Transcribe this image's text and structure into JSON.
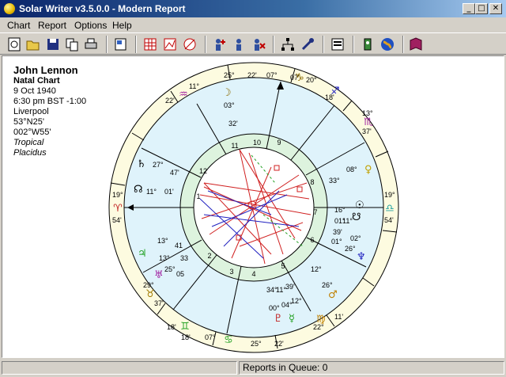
{
  "window": {
    "title": "Solar Writer  v3.5.0.0 - Modern Report",
    "btn_min": "_",
    "btn_max": "□",
    "btn_close": "✕"
  },
  "menu": [
    "Chart",
    "Report",
    "Options",
    "Help"
  ],
  "toolbar_icons": [
    "new-chart-icon",
    "open-icon",
    "save-icon",
    "copy-icon",
    "print-icon",
    "preview-icon",
    "grid-icon",
    "graph-icon",
    "bi-wheel-icon",
    "add-person-icon",
    "person-icon",
    "delete-person-icon",
    "network-icon",
    "tools-icon",
    "properties-icon",
    "transit-icon",
    "globe-icon",
    "book-icon"
  ],
  "person": {
    "name": "John Lennon",
    "chart_type": "Natal Chart",
    "date": "9 Oct 1940",
    "time": "6:30 pm BST  -1:00",
    "place": "Liverpool",
    "lat": "53°N25'",
    "lon": "002°W55'",
    "zodiac": "Tropical",
    "house_system": "Placidus"
  },
  "cusps": [
    {
      "label": "19°",
      "sub": "54'"
    },
    {
      "label": "19°",
      "sub": "54'"
    },
    {
      "label": "07°",
      "sub": "07'"
    },
    {
      "label": "25°",
      "sub": "22'"
    }
  ],
  "house_numbers": [
    "1",
    "2",
    "3",
    "4",
    "5",
    "6",
    "7",
    "8",
    "9",
    "10",
    "11",
    "12"
  ],
  "outer_labels": [
    "11°",
    "25°",
    "22'",
    "07°",
    "07'",
    "20°",
    "18'",
    "13°",
    "37'",
    "19°",
    "54'",
    "11°",
    "22°",
    "07°",
    "18'",
    "25°",
    "22'",
    "07°",
    "18'",
    "29°",
    "37'",
    "22°",
    "11'",
    "11°",
    "01'",
    "27°",
    "47'",
    "22°",
    "03°",
    "32'",
    "33°",
    "08°"
  ],
  "planet_labels": [
    "16°",
    "01°",
    "11°",
    "39'",
    "01°",
    "02°",
    "26°",
    "12°",
    "26°",
    "34°",
    "11°",
    "39'",
    "00°",
    "04°",
    "12°",
    "13°",
    "41",
    "13°",
    "33",
    "25°",
    "05"
  ],
  "status": {
    "queue": "Reports in Queue: 0"
  }
}
